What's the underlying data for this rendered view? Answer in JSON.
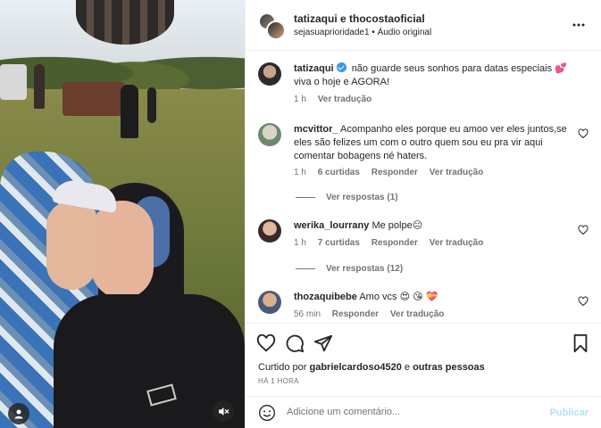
{
  "header": {
    "names": "tatizaqui e thocostaoficial",
    "audio_user": "sejasuaprioridade1",
    "audio_sep": " • ",
    "audio_label": "Áudio original"
  },
  "caption": {
    "username": "tatizaqui",
    "text": "não guarde seus sonhos para datas especiais 💕 viva o hoje e AGORA!",
    "time": "1 h",
    "translate": "Ver tradução"
  },
  "comments": [
    {
      "username": "mcvittor_",
      "text": "Acompanho eles porque eu amoo ver eles juntos,se eles são felizes um com o outro quem sou eu pra vir aqui comentar bobagens né haters.",
      "time": "1 h",
      "likes": "6 curtidas",
      "reply": "Responder",
      "translate": "Ver tradução",
      "replies": "Ver respostas (1)"
    },
    {
      "username": "werika_lourrany",
      "text": "Me polpe😐",
      "time": "1 h",
      "likes": "7 curtidas",
      "reply": "Responder",
      "translate": "Ver tradução",
      "replies": "Ver respostas (12)"
    },
    {
      "username": "thozaquibebe",
      "text": "Amo vcs 😍 😘 💝",
      "time": "56 min",
      "reply": "Responder",
      "translate": "Ver tradução"
    }
  ],
  "likes": {
    "prefix": "Curtido por ",
    "user": "gabrielcardoso4520",
    "middle": " e ",
    "others": "outras pessoas"
  },
  "time_ago": "HÁ 1 HORA",
  "add_comment": {
    "placeholder": "Adicione um comentário...",
    "post_label": "Publicar"
  },
  "colors": {
    "verified": "#3897f0",
    "muted": "#737373",
    "post_disabled": "#b2dffc"
  }
}
